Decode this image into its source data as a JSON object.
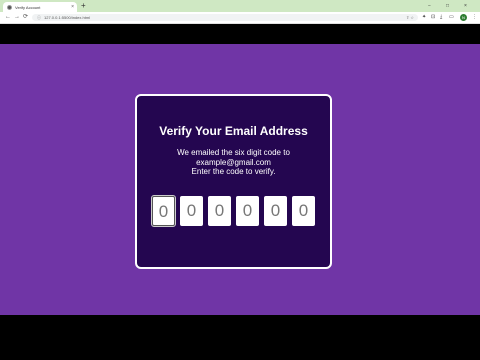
{
  "browser": {
    "tab_title": "Verify Account",
    "tab_close": "×",
    "new_tab": "+",
    "win_minimize": "−",
    "win_maximize": "□",
    "win_close": "×",
    "nav_back": "←",
    "nav_forward": "→",
    "nav_reload": "⟳",
    "url": "127.0.0.1:5500/index.html",
    "omni_icons": "⇪ ☆",
    "toolbar_icons": [
      "✦",
      "⊡",
      "⤓",
      "▭"
    ],
    "avatar_initial": "N",
    "menu": "⋮"
  },
  "card": {
    "title": "Verify Your Email Address",
    "line1": "We emailed the six digit code to",
    "line2": "example@gmail.com",
    "line3": "Enter the code to verify."
  },
  "code": {
    "digits": [
      "0",
      "0",
      "0",
      "0",
      "0",
      "0"
    ],
    "active_index": 0
  },
  "colors": {
    "background": "#7035a6",
    "card": "#240650",
    "card_border": "#ffffff",
    "tabbar": "#cfe8c3"
  }
}
